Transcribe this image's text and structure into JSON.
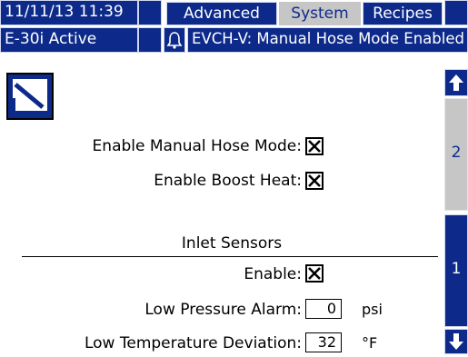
{
  "header": {
    "datetime": "11/11/13 11:39",
    "tabs": [
      {
        "label": "Advanced",
        "active": false
      },
      {
        "label": "System",
        "active": true
      },
      {
        "label": "Recipes",
        "active": false
      }
    ],
    "status": "E-30i Active",
    "alarm_icon": "bell-icon",
    "alarm_message": "EVCH-V: Manual Hose Mode Enabled"
  },
  "page_icon": "advanced-setup-icon",
  "form": {
    "manual_hose_label": "Enable Manual Hose Mode:",
    "manual_hose_checked": true,
    "boost_heat_label": "Enable Boost Heat:",
    "boost_heat_checked": true,
    "inlet_section_title": "Inlet Sensors",
    "inlet_enable_label": "Enable:",
    "inlet_enable_checked": true,
    "low_pressure_label": "Low Pressure Alarm:",
    "low_pressure_value": "0",
    "low_pressure_unit": "psi",
    "low_temp_label": "Low Temperature Deviation:",
    "low_temp_value": "32",
    "low_temp_unit": "°F"
  },
  "scroll": {
    "up_icon": "arrow-up-icon",
    "page_2": "2",
    "page_1": "1",
    "down_icon": "arrow-down-icon"
  },
  "colors": {
    "accent_blue": "#0d2a8a",
    "inactive_gray": "#c6c6c6"
  }
}
